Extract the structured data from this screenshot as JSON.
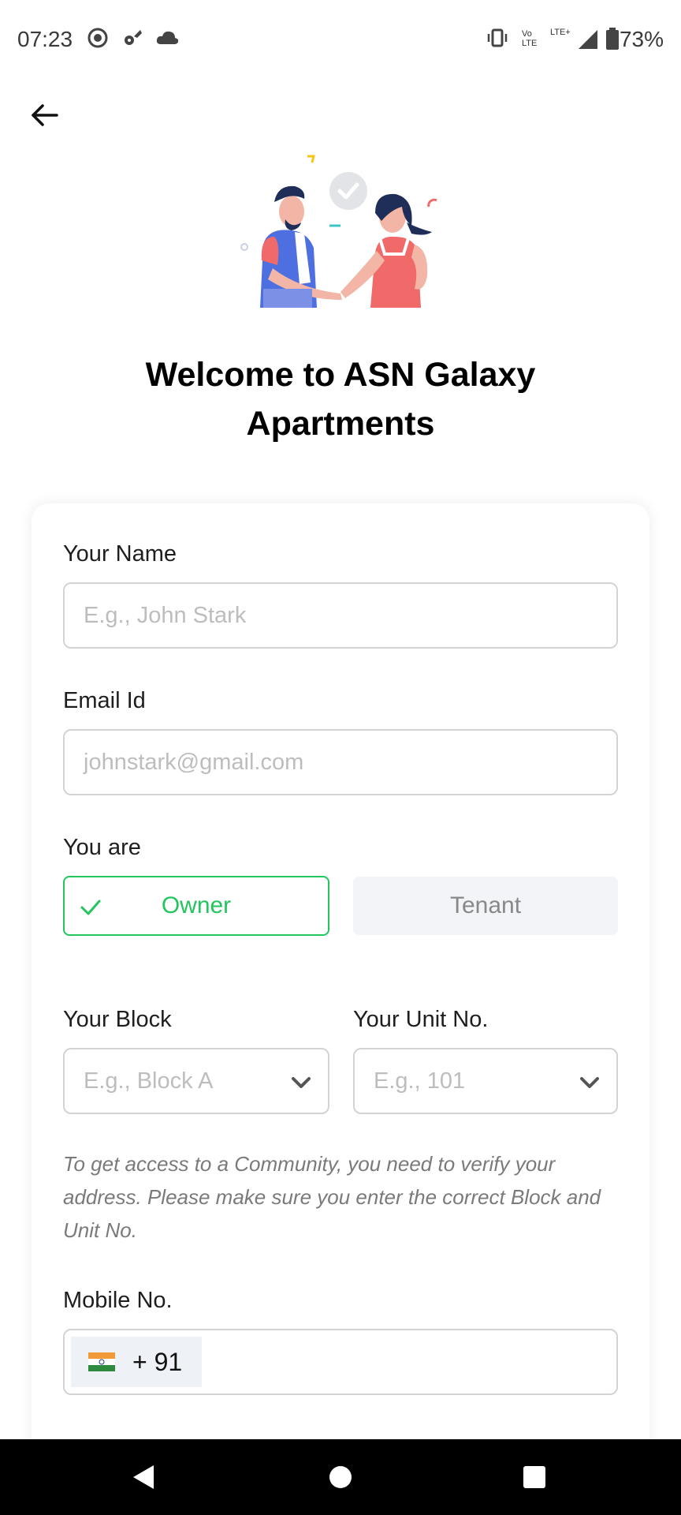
{
  "status_bar": {
    "time": "07:23",
    "battery_percent": "73%",
    "network_small_1": "Vo",
    "network_small_2": "LTE",
    "network_small_3": "LTE+"
  },
  "header": {
    "title_line1": "Welcome to ASN Galaxy",
    "title_line2": "Apartments"
  },
  "form": {
    "name_label": "Your Name",
    "name_placeholder": "E.g., John Stark",
    "email_label": "Email Id",
    "email_placeholder": "johnstark@gmail.com",
    "role_label": "You are",
    "role_options": [
      "Owner",
      "Tenant"
    ],
    "role_selected": "Owner",
    "block_label": "Your Block",
    "block_placeholder": "E.g., Block A",
    "unit_label": "Your Unit No.",
    "unit_placeholder": "E.g., 101",
    "hint": "To get access to a Community, you need to verify your address. Please make sure you enter the correct Block and Unit No.",
    "mobile_label": "Mobile No.",
    "country_code": "+ 91"
  },
  "colors": {
    "accent_green": "#22c55e",
    "tenant_bg": "#f2f4f7",
    "placeholder": "#bdbdbd"
  },
  "icons": [
    "back-arrow-icon",
    "check-icon",
    "chevron-down-icon",
    "india-flag-icon",
    "nav-back-icon",
    "nav-home-icon",
    "nav-recents-icon"
  ]
}
